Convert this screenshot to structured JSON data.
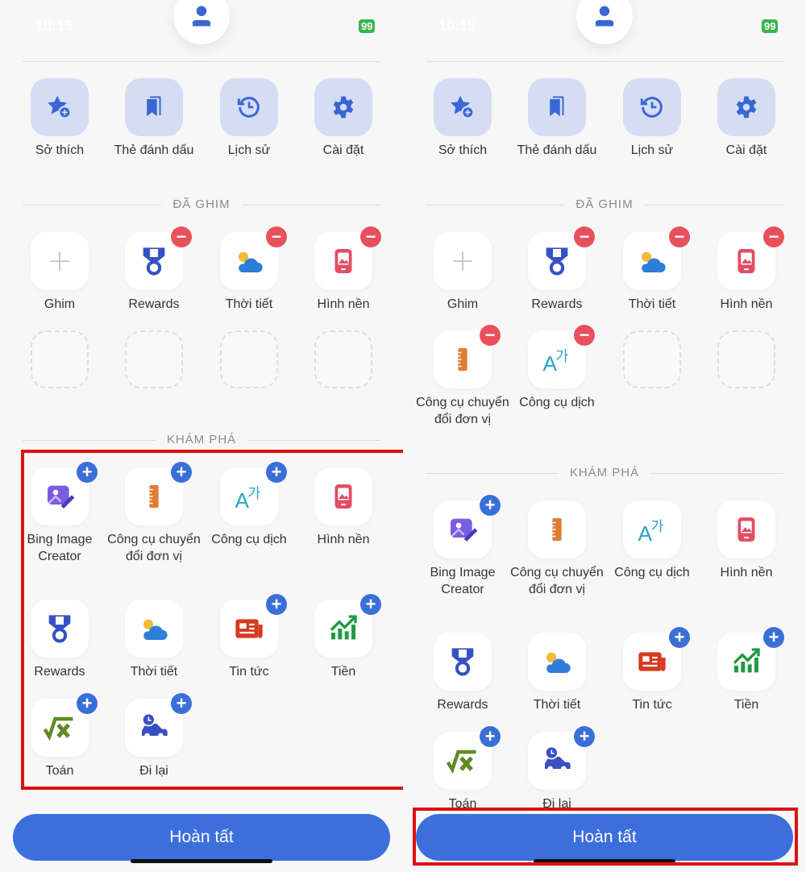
{
  "status": {
    "time": "10:15",
    "battery": "99"
  },
  "top_items": [
    {
      "label": "Sở thích",
      "icon": "star-plus-icon"
    },
    {
      "label": "Thẻ đánh dấu",
      "icon": "bookmark-icon"
    },
    {
      "label": "Lịch sử",
      "icon": "history-icon"
    },
    {
      "label": "Cài đặt",
      "icon": "gear-icon"
    }
  ],
  "pinned_heading": "ĐÃ GHIM",
  "explore_heading": "KHÁM PHÁ",
  "done_label": "Hoàn tất",
  "panels": [
    {
      "pinned": [
        {
          "label": "Ghim",
          "icon": "plus-icon",
          "kind": "add"
        },
        {
          "label": "Rewards",
          "icon": "medal-icon",
          "badge": "minus"
        },
        {
          "label": "Thời tiết",
          "icon": "weather-icon",
          "badge": "minus"
        },
        {
          "label": "Hình nền",
          "icon": "wallpaper-icon",
          "badge": "minus"
        },
        {
          "kind": "empty"
        },
        {
          "kind": "empty"
        },
        {
          "kind": "empty"
        },
        {
          "kind": "empty"
        }
      ],
      "explore": [
        {
          "label": "Bing Image Creator",
          "icon": "image-creator-icon",
          "badge": "plus"
        },
        {
          "label": "Công cụ chuyển đổi đơn vị",
          "icon": "ruler-icon",
          "badge": "plus"
        },
        {
          "label": "Công cụ dịch",
          "icon": "translate-icon",
          "badge": "plus"
        },
        {
          "label": "Hình nền",
          "icon": "wallpaper-icon"
        },
        {
          "label": "Rewards",
          "icon": "medal-icon"
        },
        {
          "label": "Thời tiết",
          "icon": "weather-icon"
        },
        {
          "label": "Tin tức",
          "icon": "news-icon",
          "badge": "plus"
        },
        {
          "label": "Tiền",
          "icon": "money-chart-icon",
          "badge": "plus"
        },
        {
          "label": "Toán",
          "icon": "math-icon",
          "badge": "plus"
        },
        {
          "label": "Đi lại",
          "icon": "car-icon",
          "badge": "plus"
        }
      ]
    },
    {
      "pinned": [
        {
          "label": "Ghim",
          "icon": "plus-icon",
          "kind": "add"
        },
        {
          "label": "Rewards",
          "icon": "medal-icon",
          "badge": "minus"
        },
        {
          "label": "Thời tiết",
          "icon": "weather-icon",
          "badge": "minus"
        },
        {
          "label": "Hình nền",
          "icon": "wallpaper-icon",
          "badge": "minus"
        },
        {
          "label": "Công cụ chuyển đổi đơn vị",
          "icon": "ruler-icon",
          "badge": "minus"
        },
        {
          "label": "Công cụ dịch",
          "icon": "translate-icon",
          "badge": "minus"
        },
        {
          "kind": "empty"
        },
        {
          "kind": "empty"
        }
      ],
      "explore": [
        {
          "label": "Bing Image Creator",
          "icon": "image-creator-icon",
          "badge": "plus"
        },
        {
          "label": "Công cụ chuyển đổi đơn vị",
          "icon": "ruler-icon"
        },
        {
          "label": "Công cụ dịch",
          "icon": "translate-icon"
        },
        {
          "label": "Hình nền",
          "icon": "wallpaper-icon"
        },
        {
          "label": "Rewards",
          "icon": "medal-icon"
        },
        {
          "label": "Thời tiết",
          "icon": "weather-icon"
        },
        {
          "label": "Tin tức",
          "icon": "news-icon",
          "badge": "plus"
        },
        {
          "label": "Tiền",
          "icon": "money-chart-icon",
          "badge": "plus"
        },
        {
          "label": "Toán",
          "icon": "math-icon",
          "badge": "plus"
        },
        {
          "label": "Đi lại",
          "icon": "car-icon",
          "badge": "plus"
        }
      ]
    }
  ],
  "colors": {
    "accent": "#3d6fdc",
    "remove": "#e8505b",
    "highlight": "#dd1111"
  }
}
